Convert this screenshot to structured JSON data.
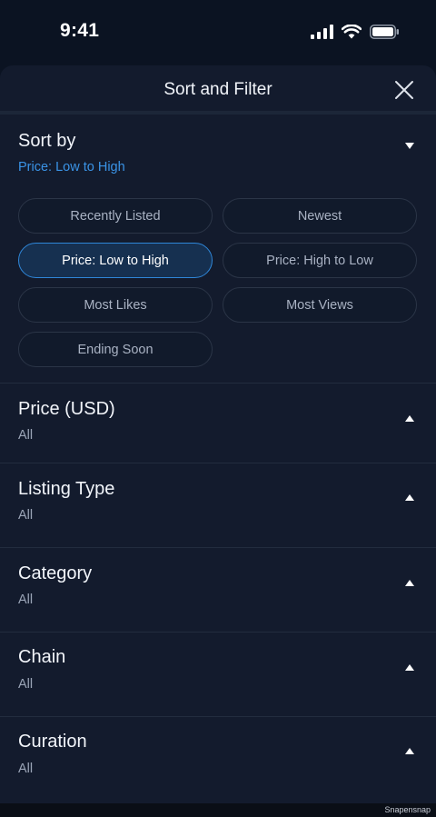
{
  "status_bar": {
    "time": "9:41"
  },
  "sheet": {
    "title": "Sort and Filter"
  },
  "sort": {
    "title": "Sort by",
    "value": "Price: Low to High",
    "options": [
      "Recently Listed",
      "Newest",
      "Price: Low to High",
      "Price: High to Low",
      "Most Likes",
      "Most Views",
      "Ending Soon"
    ],
    "selected": "Price: Low to High"
  },
  "filters": [
    {
      "title": "Price (USD)",
      "value": "All"
    },
    {
      "title": "Listing Type",
      "value": "All"
    },
    {
      "title": "Category",
      "value": "All"
    },
    {
      "title": "Chain",
      "value": "All"
    },
    {
      "title": "Curation",
      "value": "All"
    }
  ],
  "footer": {
    "watermark": "Snapensnap"
  },
  "colors": {
    "accent": "#2f86d8",
    "accent_text": "#3a93e6",
    "sheet_bg": "#131b2d",
    "page_bg": "#0b1322"
  }
}
